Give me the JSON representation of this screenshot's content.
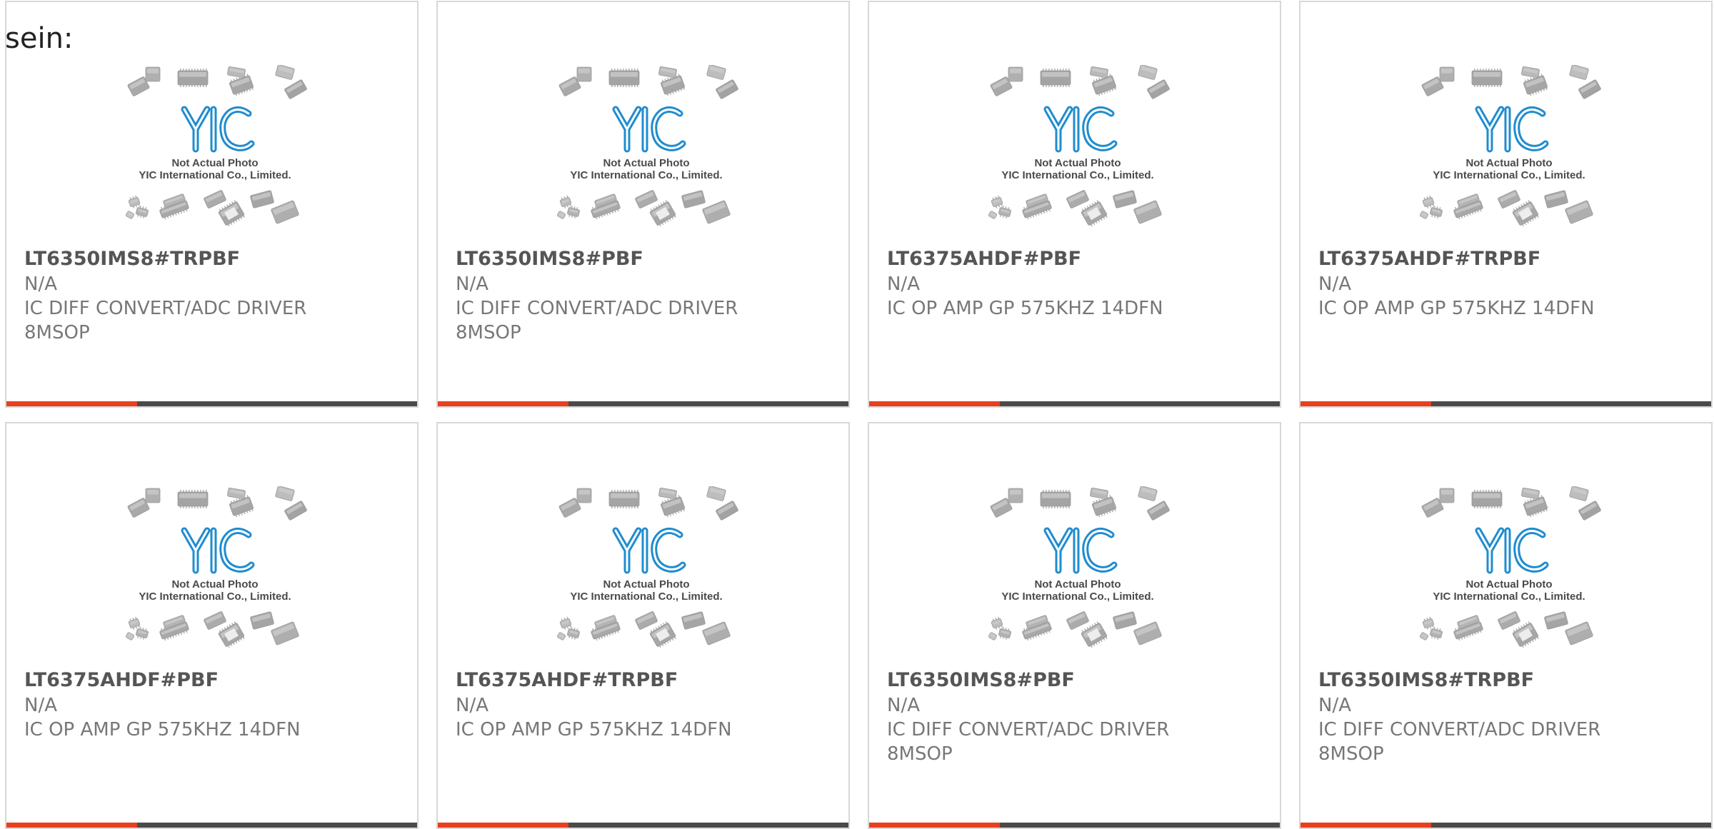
{
  "intro_text": "sein:",
  "colors": {
    "accent": "#e8401c",
    "bar": "#4a4a4a",
    "border": "#d8d8d8",
    "text": "#777777",
    "part_text": "#555555",
    "logo_blue": "#1f8ccf"
  },
  "placeholder_image": {
    "line1": "Not Actual Photo",
    "line2": "YIC International Co., Limited.",
    "logo_text": "YIC"
  },
  "products": [
    {
      "part": "LT6350IMS8#TRPBF",
      "manufacturer": "N/A",
      "description": "IC DIFF CONVERT/ADC DRIVER 8MSOP"
    },
    {
      "part": "LT6350IMS8#PBF",
      "manufacturer": "N/A",
      "description": "IC DIFF CONVERT/ADC DRIVER 8MSOP"
    },
    {
      "part": "LT6375AHDF#PBF",
      "manufacturer": "N/A",
      "description": "IC OP AMP GP 575KHZ 14DFN"
    },
    {
      "part": "LT6375AHDF#TRPBF",
      "manufacturer": "N/A",
      "description": "IC OP AMP GP 575KHZ 14DFN"
    },
    {
      "part": "LT6375AHDF#PBF",
      "manufacturer": "N/A",
      "description": "IC OP AMP GP 575KHZ 14DFN"
    },
    {
      "part": "LT6375AHDF#TRPBF",
      "manufacturer": "N/A",
      "description": "IC OP AMP GP 575KHZ 14DFN"
    },
    {
      "part": "LT6350IMS8#PBF",
      "manufacturer": "N/A",
      "description": "IC DIFF CONVERT/ADC DRIVER 8MSOP"
    },
    {
      "part": "LT6350IMS8#TRPBF",
      "manufacturer": "N/A",
      "description": "IC DIFF CONVERT/ADC DRIVER 8MSOP"
    }
  ]
}
